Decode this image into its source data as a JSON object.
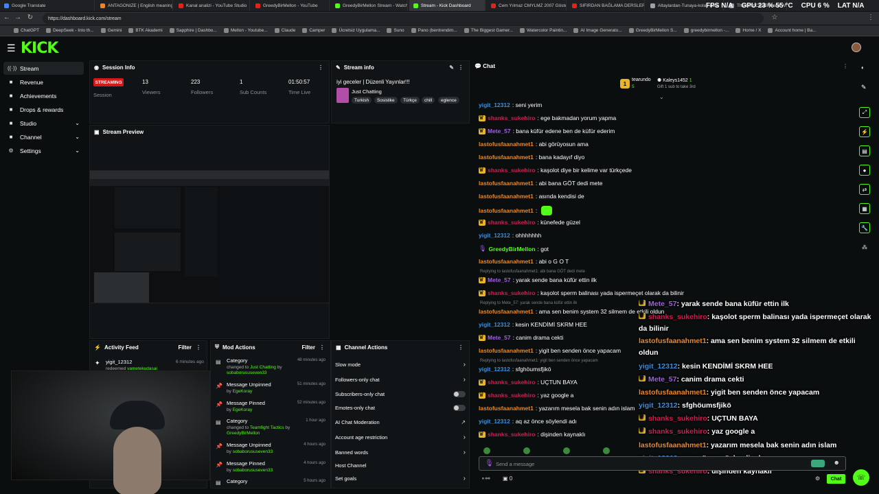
{
  "tabs": [
    {
      "label": "Google Translate",
      "color": "#4285f4"
    },
    {
      "label": "ANTAGONIZE | English meaning",
      "color": "#e8872a"
    },
    {
      "label": "Kanal analizi - YouTube Studio",
      "color": "#e62117"
    },
    {
      "label": "GreedyBirMellon - YouTube",
      "color": "#e62117"
    },
    {
      "label": "GreedyBirMellon Stream - Watch",
      "color": "#53fc18"
    },
    {
      "label": "Stream - Kick Dashboard",
      "color": "#53fc18"
    },
    {
      "label": "Cem Yılmaz CMYLMZ 2007 Gösteri",
      "color": "#e62117"
    },
    {
      "label": "SIFIRDAN BAĞLAMA DERSLERİ",
      "color": "#e62117"
    },
    {
      "label": "Altaylardan-Tunaya-kolay-nota",
      "color": "#9aa0a6"
    },
    {
      "label": "The best ChatBot and Widgets",
      "color": "#9aa0a6"
    }
  ],
  "overlay_stats": {
    "fps": "FPS",
    "fps_val": "N/A",
    "gpu": "GPU",
    "gpu_val": "23 % 55 °C",
    "cpu": "CPU",
    "cpu_val": "6 %",
    "lat": "LAT",
    "lat_val": "N/A"
  },
  "url": "https://dashboard.kick.com/stream",
  "bookmarks": [
    "ChatGPT",
    "DeepSeek - Into th...",
    "Gemini",
    "BTK Akademi",
    "Sapphire | Dashbo...",
    "Mellon - Youtube...",
    "Claude",
    "Camper",
    "Ücretsiz Uygulama...",
    "Suno",
    "Pano (bentrendim...",
    "The Biggest Gamer...",
    "Watercolor Paintin...",
    "AI Image Generato...",
    "GreedyBirMellon S...",
    "greedybirmellon -...",
    "Home / X",
    "Account home | Ba..."
  ],
  "brand": {
    "logo": "KICK",
    "accent": "#53fc18"
  },
  "sidebar": [
    {
      "label": "Stream",
      "icon": "stream-icon",
      "glyph": "((·))",
      "active": true
    },
    {
      "label": "Revenue",
      "icon": "revenue-icon",
      "glyph": "■"
    },
    {
      "label": "Achievements",
      "icon": "trophy-icon",
      "glyph": "■"
    },
    {
      "label": "Drops & rewards",
      "icon": "gift-icon",
      "glyph": "■"
    },
    {
      "label": "Studio",
      "icon": "studio-icon",
      "glyph": "■",
      "expand": true
    },
    {
      "label": "Channel",
      "icon": "channel-icon",
      "glyph": "■",
      "expand": true
    },
    {
      "label": "Settings",
      "icon": "gear-icon",
      "glyph": "⚙",
      "expand": true
    }
  ],
  "session": {
    "title": "Session Info",
    "badge": "STREAMING",
    "session_label": "Session",
    "stats": [
      {
        "value": "13",
        "label": "Viewers"
      },
      {
        "value": "223",
        "label": "Followers"
      },
      {
        "value": "1",
        "label": "Sub Counts"
      },
      {
        "value": "01:50:57",
        "label": "Time Live"
      }
    ]
  },
  "preview": {
    "title": "Stream Preview"
  },
  "stream_info": {
    "title": "Stream info",
    "stream_title": "iyi geceler | Düzenli Yayınlar!!!",
    "category": "Just Chatting",
    "tags": [
      "Turkish",
      "Sosislike",
      "Türkçe",
      "chill",
      "eglence"
    ]
  },
  "activity": {
    "title": "Activity Feed",
    "filter": "Filter",
    "items": [
      {
        "user": "yigit_12312",
        "time": "6 minutes ago",
        "action": "redeemed",
        "reward": "vametekudasai"
      }
    ]
  },
  "mod_actions": {
    "title": "Mod Actions",
    "filter": "Filter",
    "items": [
      {
        "title": "Category",
        "sub1": "changed to",
        "hl": "Just Chatting",
        "sub2": "by",
        "by": "sobaborususeven33",
        "time": "48 minutes ago"
      },
      {
        "title": "Message Unpinned",
        "sub1": "",
        "hl": "",
        "sub2": "by",
        "by": "EgeKoray",
        "time": "51 minutes ago"
      },
      {
        "title": "Message Pinned",
        "sub1": "",
        "hl": "",
        "sub2": "by",
        "by": "EgeKoray",
        "time": "52 minutes ago"
      },
      {
        "title": "Category",
        "sub1": "changed to",
        "hl": "Teamfight Tactics",
        "sub2": "by",
        "by": "GreedyBirMellon",
        "time": "1 hour ago"
      },
      {
        "title": "Message Unpinned",
        "sub1": "",
        "hl": "",
        "sub2": "by",
        "by": "sobaborususeven33",
        "time": "4 hours ago"
      },
      {
        "title": "Message Pinned",
        "sub1": "",
        "hl": "",
        "sub2": "by",
        "by": "sobaborususeven33",
        "time": "4 hours ago"
      },
      {
        "title": "Category",
        "sub1": "",
        "hl": "",
        "sub2": "",
        "by": "",
        "time": "5 hours ago"
      }
    ]
  },
  "channel_actions": {
    "title": "Channel Actions",
    "items": [
      {
        "label": "Slow mode",
        "ctrl": "arrow"
      },
      {
        "label": "Followers-only chat",
        "ctrl": "arrow"
      },
      {
        "label": "Subscribers-only chat",
        "ctrl": "toggle"
      },
      {
        "label": "Emotes-only chat",
        "ctrl": "toggle"
      },
      {
        "label": "AI Chat Moderation",
        "ctrl": "ext"
      },
      {
        "label": "Account age restriction",
        "ctrl": "arrow"
      },
      {
        "label": "Banned words",
        "ctrl": "arrow"
      },
      {
        "label": "Host Channel",
        "ctrl": "none"
      },
      {
        "label": "Set goals",
        "ctrl": "arrow"
      }
    ]
  },
  "chat": {
    "title": "Chat",
    "leaderboard": {
      "user1": "tearundo",
      "user1_count": "5",
      "user2": "Kaleys1452",
      "user2_count": "1",
      "gift_note": "Gift 1 sub to take 3rd"
    },
    "messages": [
      {
        "user": "yigit_12312",
        "c": "blue",
        "text": ": seni yerim"
      },
      {
        "user": "shanks_sukehiro",
        "c": "red",
        "badge": true,
        "text": ": ege bakmadan yorum yapma"
      },
      {
        "user": "Mete_57",
        "c": "purple",
        "badge": true,
        "text": ": bana küfür edene ben de küfür ederim"
      },
      {
        "user": "lastofusfaanahmet1",
        "c": "orange",
        "text": ": abi görüyosun ama"
      },
      {
        "user": "lastofusfaanahmet1",
        "c": "orange",
        "text": ": bana kadayıf diyo"
      },
      {
        "user": "shanks_sukehiro",
        "c": "red",
        "badge": true,
        "text": ": kaşolot diye bir kelime var türkçede"
      },
      {
        "user": "lastofusfaanahmet1",
        "c": "orange",
        "text": ": abi bana GÖT dedi mete"
      },
      {
        "user": "lastofusfaanahmet1",
        "c": "orange",
        "text": ": asında kendisi de"
      },
      {
        "user": "lastofusfaanahmet1",
        "c": "orange",
        "text": ":"
      },
      {
        "user": "shanks_sukehiro",
        "c": "red",
        "badge": true,
        "text": ": künefede güzel"
      },
      {
        "user": "yigit_12312",
        "c": "blue",
        "text": ": ohhhhhhh"
      },
      {
        "user": "GreedyBirMellon",
        "c": "green",
        "badge": true,
        "text": ": got"
      },
      {
        "user": "lastofusfaanahmet1",
        "c": "orange",
        "text": ": abi o G O T"
      },
      {
        "user": "Mete_57",
        "c": "purple",
        "badge": true,
        "text": ": yarak sende bana küfür ettin ilk",
        "reply": "Replying to lastofusfaanahmet1: abi bana GÖT dedi mete"
      },
      {
        "user": "shanks_sukehiro",
        "c": "red",
        "badge": true,
        "text": ": kaşolot sperm balinası yada ispermeçet olarak da bilinir"
      },
      {
        "user": "lastofusfaanahmet1",
        "c": "orange",
        "text": ": ama sen benim system 32 silmem de etkili oldun",
        "reply": "Replying to Mete_57: yarak sende bana küfür ettin ilk"
      },
      {
        "user": "yigit_12312",
        "c": "blue",
        "text": ": kesin KENDİMİ SKRM HEE"
      },
      {
        "user": "Mete_57",
        "c": "purple",
        "badge": true,
        "text": ": canim drama cekti"
      },
      {
        "user": "lastofusfaanahmet1",
        "c": "orange",
        "text": ": yigit ben senden önce yapacam"
      },
      {
        "user": "yigit_12312",
        "c": "blue",
        "text": ": sfghöumsfjikö",
        "reply": "Replying to lastofusfaanahmet1: yigit ben senden önce yapacam"
      },
      {
        "user": "shanks_sukehiro",
        "c": "red",
        "badge": true,
        "text": ": UÇTUN BAYA"
      },
      {
        "user": "shanks_sukehiro",
        "c": "red",
        "badge": true,
        "text": ": yaz google a"
      },
      {
        "user": "lastofusfaanahmet1",
        "c": "orange",
        "text": ": yazarım mesela bak senin adın islam"
      },
      {
        "user": "yigit_12312",
        "c": "blue",
        "text": ": aq az önce söylendi adı"
      },
      {
        "user": "shanks_sukehiro",
        "c": "red",
        "badge": true,
        "text": ": dişinden kaynaklı"
      }
    ],
    "input_placeholder": "Send a message",
    "send_label": "Chat",
    "viewer_count": "0"
  },
  "overlay_chat": [
    {
      "user": "Mete_57",
      "c": "purple",
      "badge": true,
      "text": ": yarak sende bana küfür ettin ilk"
    },
    {
      "user": "shanks_sukehiro",
      "c": "red",
      "badge": true,
      "text": ": kaşolot sperm balinası yada ispermeçet olarak"
    },
    {
      "user": "",
      "c": "",
      "text": "da bilinir"
    },
    {
      "user": "lastofusfaanahmet1",
      "c": "orange",
      "text": ": ama sen benim system 32 silmem de etkili"
    },
    {
      "user": "",
      "c": "",
      "text": "oldun"
    },
    {
      "user": "yigit_12312",
      "c": "blue",
      "text": ": kesin KENDİMİ SKRM HEE"
    },
    {
      "user": "Mete_57",
      "c": "purple",
      "badge": true,
      "text": ": canim drama cekti"
    },
    {
      "user": "lastofusfaanahmet1",
      "c": "orange",
      "text": ": yigit ben senden önce yapacam"
    },
    {
      "user": "yigit_12312",
      "c": "blue",
      "text": ": sfghöumsfjikö"
    },
    {
      "user": "shanks_sukehiro",
      "c": "red",
      "badge": true,
      "text": ": UÇTUN BAYA"
    },
    {
      "user": "shanks_sukehiro",
      "c": "red",
      "badge": true,
      "text": ": yaz google a"
    },
    {
      "user": "lastofusfaanahmet1",
      "c": "orange",
      "text": ": yazarım mesela bak senin adın islam"
    },
    {
      "user": "yigit_12312",
      "c": "blue",
      "text": ": aq az önce söylendi adı"
    },
    {
      "user": "shanks_sukehiro",
      "c": "red",
      "badge": true,
      "text": ": dişinden kaynaklı"
    }
  ],
  "rail_icons": [
    "lightning-icon",
    "document-icon",
    "chat-bubble-icon",
    "swap-icon",
    "calendar-icon",
    "wrench-icon",
    "network-icon"
  ]
}
